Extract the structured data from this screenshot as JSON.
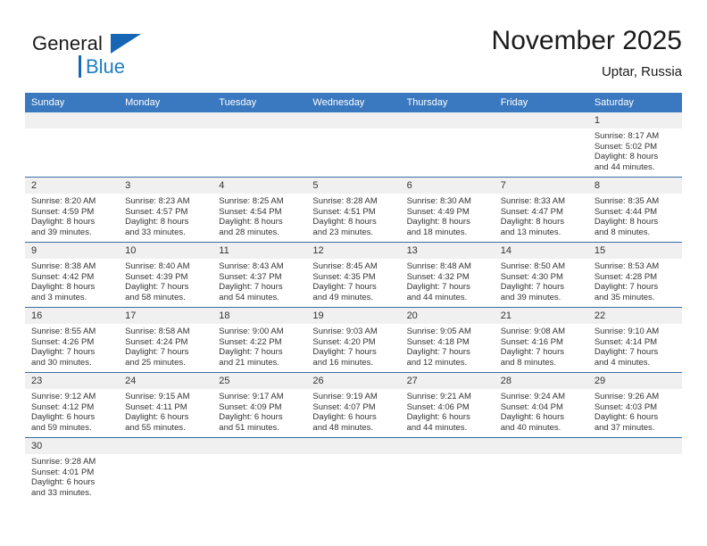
{
  "brand": {
    "word1": "General",
    "word2": "Blue",
    "logo_icon": "blue-triangle-icon"
  },
  "header": {
    "title": "November 2025",
    "subtitle": "Uptar, Russia"
  },
  "theme": {
    "header_blue": "#3a78bf",
    "row_divider": "#3a6ea5",
    "daynum_band": "#f0f0f0",
    "brand_blue": "#1f7ec4"
  },
  "columns": [
    "Sunday",
    "Monday",
    "Tuesday",
    "Wednesday",
    "Thursday",
    "Friday",
    "Saturday"
  ],
  "weeks": [
    [
      {
        "day": "",
        "empty": true
      },
      {
        "day": "",
        "empty": true
      },
      {
        "day": "",
        "empty": true
      },
      {
        "day": "",
        "empty": true
      },
      {
        "day": "",
        "empty": true
      },
      {
        "day": "",
        "empty": true
      },
      {
        "day": "1",
        "sunrise": "Sunrise: 8:17 AM",
        "sunset": "Sunset: 5:02 PM",
        "daylight1": "Daylight: 8 hours",
        "daylight2": "and 44 minutes."
      }
    ],
    [
      {
        "day": "2",
        "sunrise": "Sunrise: 8:20 AM",
        "sunset": "Sunset: 4:59 PM",
        "daylight1": "Daylight: 8 hours",
        "daylight2": "and 39 minutes."
      },
      {
        "day": "3",
        "sunrise": "Sunrise: 8:23 AM",
        "sunset": "Sunset: 4:57 PM",
        "daylight1": "Daylight: 8 hours",
        "daylight2": "and 33 minutes."
      },
      {
        "day": "4",
        "sunrise": "Sunrise: 8:25 AM",
        "sunset": "Sunset: 4:54 PM",
        "daylight1": "Daylight: 8 hours",
        "daylight2": "and 28 minutes."
      },
      {
        "day": "5",
        "sunrise": "Sunrise: 8:28 AM",
        "sunset": "Sunset: 4:51 PM",
        "daylight1": "Daylight: 8 hours",
        "daylight2": "and 23 minutes."
      },
      {
        "day": "6",
        "sunrise": "Sunrise: 8:30 AM",
        "sunset": "Sunset: 4:49 PM",
        "daylight1": "Daylight: 8 hours",
        "daylight2": "and 18 minutes."
      },
      {
        "day": "7",
        "sunrise": "Sunrise: 8:33 AM",
        "sunset": "Sunset: 4:47 PM",
        "daylight1": "Daylight: 8 hours",
        "daylight2": "and 13 minutes."
      },
      {
        "day": "8",
        "sunrise": "Sunrise: 8:35 AM",
        "sunset": "Sunset: 4:44 PM",
        "daylight1": "Daylight: 8 hours",
        "daylight2": "and 8 minutes."
      }
    ],
    [
      {
        "day": "9",
        "sunrise": "Sunrise: 8:38 AM",
        "sunset": "Sunset: 4:42 PM",
        "daylight1": "Daylight: 8 hours",
        "daylight2": "and 3 minutes."
      },
      {
        "day": "10",
        "sunrise": "Sunrise: 8:40 AM",
        "sunset": "Sunset: 4:39 PM",
        "daylight1": "Daylight: 7 hours",
        "daylight2": "and 58 minutes."
      },
      {
        "day": "11",
        "sunrise": "Sunrise: 8:43 AM",
        "sunset": "Sunset: 4:37 PM",
        "daylight1": "Daylight: 7 hours",
        "daylight2": "and 54 minutes."
      },
      {
        "day": "12",
        "sunrise": "Sunrise: 8:45 AM",
        "sunset": "Sunset: 4:35 PM",
        "daylight1": "Daylight: 7 hours",
        "daylight2": "and 49 minutes."
      },
      {
        "day": "13",
        "sunrise": "Sunrise: 8:48 AM",
        "sunset": "Sunset: 4:32 PM",
        "daylight1": "Daylight: 7 hours",
        "daylight2": "and 44 minutes."
      },
      {
        "day": "14",
        "sunrise": "Sunrise: 8:50 AM",
        "sunset": "Sunset: 4:30 PM",
        "daylight1": "Daylight: 7 hours",
        "daylight2": "and 39 minutes."
      },
      {
        "day": "15",
        "sunrise": "Sunrise: 8:53 AM",
        "sunset": "Sunset: 4:28 PM",
        "daylight1": "Daylight: 7 hours",
        "daylight2": "and 35 minutes."
      }
    ],
    [
      {
        "day": "16",
        "sunrise": "Sunrise: 8:55 AM",
        "sunset": "Sunset: 4:26 PM",
        "daylight1": "Daylight: 7 hours",
        "daylight2": "and 30 minutes."
      },
      {
        "day": "17",
        "sunrise": "Sunrise: 8:58 AM",
        "sunset": "Sunset: 4:24 PM",
        "daylight1": "Daylight: 7 hours",
        "daylight2": "and 25 minutes."
      },
      {
        "day": "18",
        "sunrise": "Sunrise: 9:00 AM",
        "sunset": "Sunset: 4:22 PM",
        "daylight1": "Daylight: 7 hours",
        "daylight2": "and 21 minutes."
      },
      {
        "day": "19",
        "sunrise": "Sunrise: 9:03 AM",
        "sunset": "Sunset: 4:20 PM",
        "daylight1": "Daylight: 7 hours",
        "daylight2": "and 16 minutes."
      },
      {
        "day": "20",
        "sunrise": "Sunrise: 9:05 AM",
        "sunset": "Sunset: 4:18 PM",
        "daylight1": "Daylight: 7 hours",
        "daylight2": "and 12 minutes."
      },
      {
        "day": "21",
        "sunrise": "Sunrise: 9:08 AM",
        "sunset": "Sunset: 4:16 PM",
        "daylight1": "Daylight: 7 hours",
        "daylight2": "and 8 minutes."
      },
      {
        "day": "22",
        "sunrise": "Sunrise: 9:10 AM",
        "sunset": "Sunset: 4:14 PM",
        "daylight1": "Daylight: 7 hours",
        "daylight2": "and 4 minutes."
      }
    ],
    [
      {
        "day": "23",
        "sunrise": "Sunrise: 9:12 AM",
        "sunset": "Sunset: 4:12 PM",
        "daylight1": "Daylight: 6 hours",
        "daylight2": "and 59 minutes."
      },
      {
        "day": "24",
        "sunrise": "Sunrise: 9:15 AM",
        "sunset": "Sunset: 4:11 PM",
        "daylight1": "Daylight: 6 hours",
        "daylight2": "and 55 minutes."
      },
      {
        "day": "25",
        "sunrise": "Sunrise: 9:17 AM",
        "sunset": "Sunset: 4:09 PM",
        "daylight1": "Daylight: 6 hours",
        "daylight2": "and 51 minutes."
      },
      {
        "day": "26",
        "sunrise": "Sunrise: 9:19 AM",
        "sunset": "Sunset: 4:07 PM",
        "daylight1": "Daylight: 6 hours",
        "daylight2": "and 48 minutes."
      },
      {
        "day": "27",
        "sunrise": "Sunrise: 9:21 AM",
        "sunset": "Sunset: 4:06 PM",
        "daylight1": "Daylight: 6 hours",
        "daylight2": "and 44 minutes."
      },
      {
        "day": "28",
        "sunrise": "Sunrise: 9:24 AM",
        "sunset": "Sunset: 4:04 PM",
        "daylight1": "Daylight: 6 hours",
        "daylight2": "and 40 minutes."
      },
      {
        "day": "29",
        "sunrise": "Sunrise: 9:26 AM",
        "sunset": "Sunset: 4:03 PM",
        "daylight1": "Daylight: 6 hours",
        "daylight2": "and 37 minutes."
      }
    ],
    [
      {
        "day": "30",
        "sunrise": "Sunrise: 9:28 AM",
        "sunset": "Sunset: 4:01 PM",
        "daylight1": "Daylight: 6 hours",
        "daylight2": "and 33 minutes."
      },
      {
        "day": "",
        "empty": true
      },
      {
        "day": "",
        "empty": true
      },
      {
        "day": "",
        "empty": true
      },
      {
        "day": "",
        "empty": true
      },
      {
        "day": "",
        "empty": true
      },
      {
        "day": "",
        "empty": true
      }
    ]
  ]
}
